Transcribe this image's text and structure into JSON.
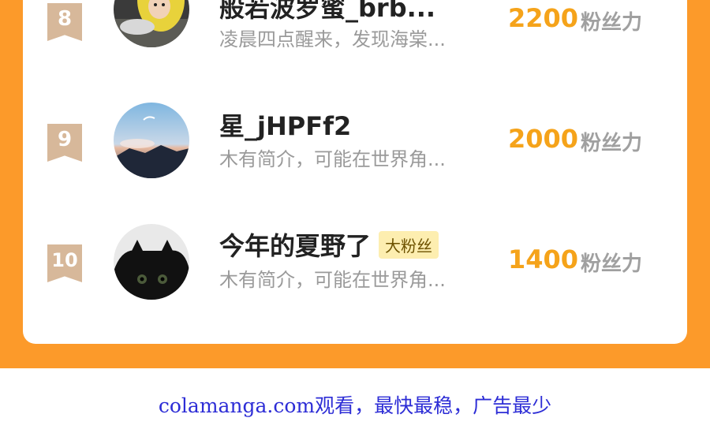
{
  "ranking": {
    "score_unit": "粉丝力",
    "rows": [
      {
        "rank": "8",
        "name": "般若波罗蜜_brb...",
        "badge": "",
        "desc": "凌晨四点醒来，发现海棠...",
        "score": "2200"
      },
      {
        "rank": "9",
        "name": "星_jHPFf2",
        "badge": "",
        "desc": "木有简介，可能在世界角...",
        "score": "2000"
      },
      {
        "rank": "10",
        "name": "今年的夏野了",
        "badge": "大粉丝",
        "desc": "木有简介，可能在世界角...",
        "score": "1400"
      }
    ]
  },
  "colors": {
    "background_orange": "#fc9a2a",
    "score_gold": "#f5a31a",
    "rank_badge": "#d7b89a",
    "footer_link": "#2d2dd6"
  },
  "footer": {
    "text": "colamanga.com观看，最快最稳，广告最少"
  }
}
